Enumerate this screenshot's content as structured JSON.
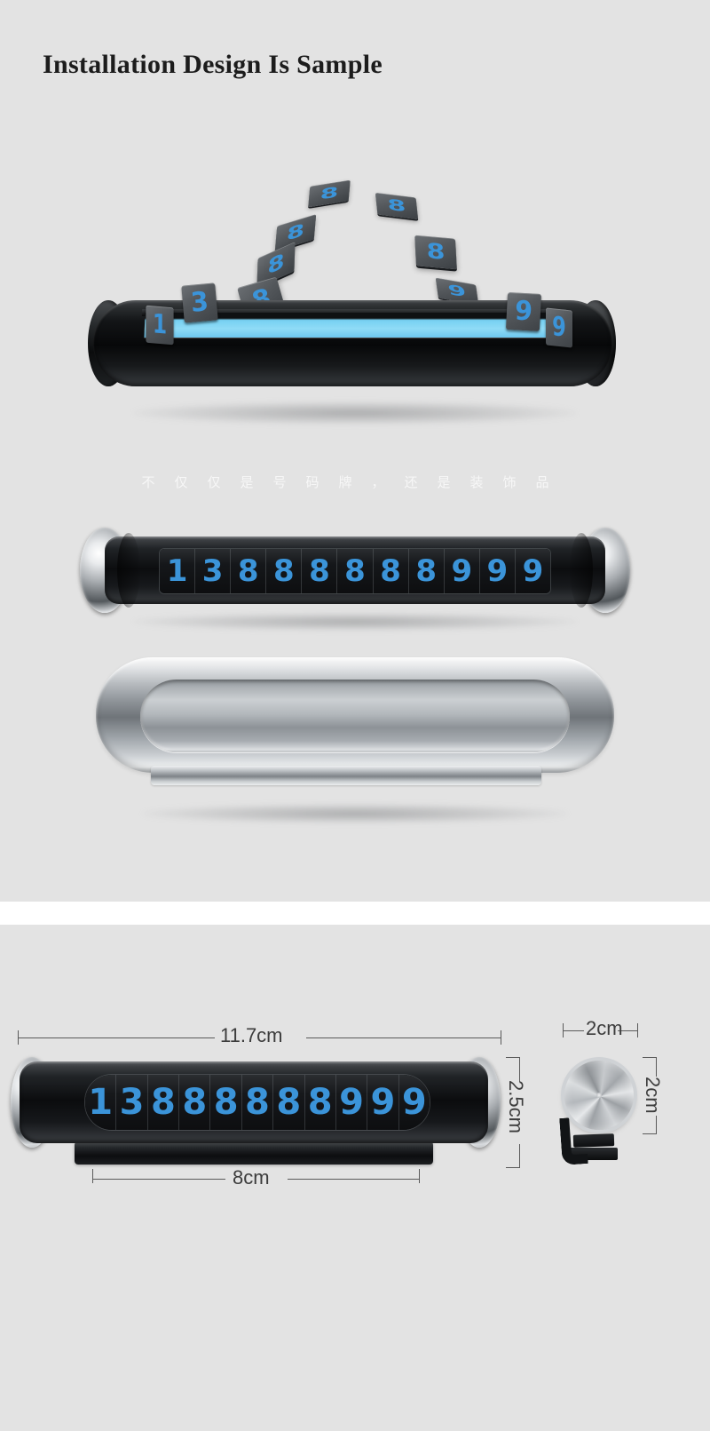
{
  "page": {
    "background": "#e3e3e3",
    "divider_color": "#ffffff",
    "accent_blue": "#3b94d9",
    "channel_blue": "#8fdbf6"
  },
  "header": {
    "title": "Installation Design Is Sample"
  },
  "watermark": {
    "text": "不仅仅是号码牌，还是装饰品"
  },
  "views": {
    "exploded": {
      "name": "exploded-assembly-view",
      "floating_tiles": [
        {
          "value": "8"
        },
        {
          "value": "8"
        },
        {
          "value": "8"
        },
        {
          "value": "8"
        },
        {
          "value": "8"
        },
        {
          "value": "8"
        },
        {
          "value": "9"
        }
      ],
      "seated_tiles": [
        {
          "value": "1"
        },
        {
          "value": "3"
        },
        {
          "value": "9"
        },
        {
          "value": "9"
        }
      ]
    },
    "assembled": {
      "name": "assembled-plate-view",
      "phone_number": "13888888999",
      "digits": [
        "1",
        "3",
        "8",
        "8",
        "8",
        "8",
        "8",
        "8",
        "9",
        "9",
        "9"
      ]
    },
    "back": {
      "name": "silver-back-view"
    }
  },
  "dimensions": {
    "front": {
      "phone_number": "13888888999",
      "digits": [
        "1",
        "3",
        "8",
        "8",
        "8",
        "8",
        "8",
        "8",
        "9",
        "9",
        "9"
      ],
      "width_label": "11.7cm",
      "height_label": "2.5cm",
      "base_width_label": "8cm"
    },
    "side": {
      "width_label": "2cm",
      "height_label": "2cm"
    }
  }
}
